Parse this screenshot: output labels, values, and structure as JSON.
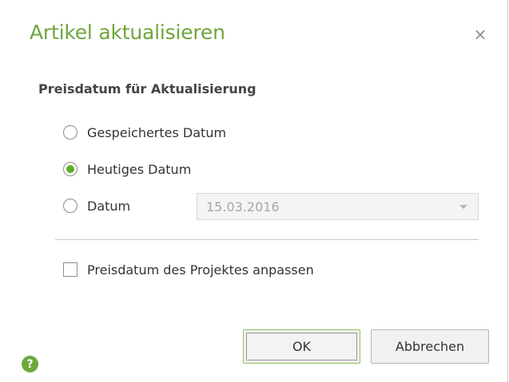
{
  "dialog": {
    "title": "Artikel aktualisieren",
    "close_glyph": "×",
    "close_icon": "close-icon",
    "accent_color": "#6fa53c"
  },
  "price_date": {
    "section_label": "Preisdatum für Aktualisierung",
    "options": [
      {
        "label": "Gespeichertes Datum",
        "selected": false
      },
      {
        "label": "Heutiges Datum",
        "selected": true
      },
      {
        "label": "Datum",
        "selected": false
      }
    ],
    "date_field": {
      "value": "15.03.2016",
      "enabled": false,
      "icon": "chevron-down-icon"
    }
  },
  "adjust_project": {
    "label": "Preisdatum des Projektes anpassen",
    "checked": false
  },
  "buttons": {
    "ok_label": "OK",
    "cancel_label": "Abbrechen"
  },
  "help": {
    "glyph": "?",
    "icon": "help-icon"
  }
}
